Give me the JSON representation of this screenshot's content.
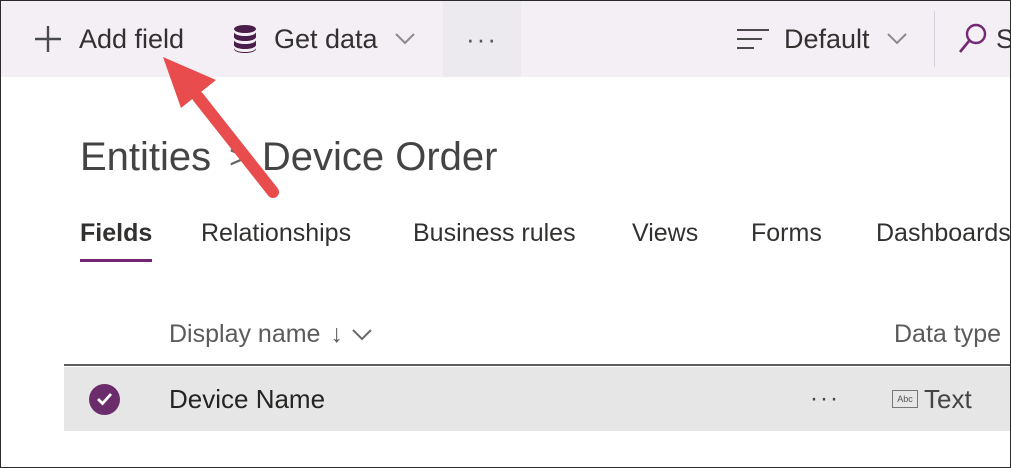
{
  "toolbar": {
    "add_field_label": "Add field",
    "get_data_label": "Get data",
    "more_label": "···",
    "view_label": "Default",
    "search_label": "S"
  },
  "breadcrumb": {
    "root": "Entities",
    "separator": ">",
    "current": "Device Order"
  },
  "tabs": [
    {
      "label": "Fields",
      "active": true
    },
    {
      "label": "Relationships",
      "active": false
    },
    {
      "label": "Business rules",
      "active": false
    },
    {
      "label": "Views",
      "active": false
    },
    {
      "label": "Forms",
      "active": false
    },
    {
      "label": "Dashboards",
      "active": false
    }
  ],
  "table": {
    "columns": {
      "display_name": "Display name",
      "sort_arrow": "↓",
      "data_type": "Data type"
    },
    "rows": [
      {
        "name": "Device Name",
        "more": "···",
        "type_icon": "Abc",
        "type": "Text",
        "selected": true
      }
    ]
  },
  "colors": {
    "accent": "#742774",
    "toolbar_bg": "#f3eff5",
    "selected_row_bg": "#e6e6e6",
    "annotation_arrow": "#e84c4c"
  },
  "icons": [
    "plus-icon",
    "database-icon",
    "chevron-down-icon",
    "list-lines-icon",
    "search-icon",
    "checkmark-icon",
    "text-type-icon",
    "annotation-arrow"
  ]
}
